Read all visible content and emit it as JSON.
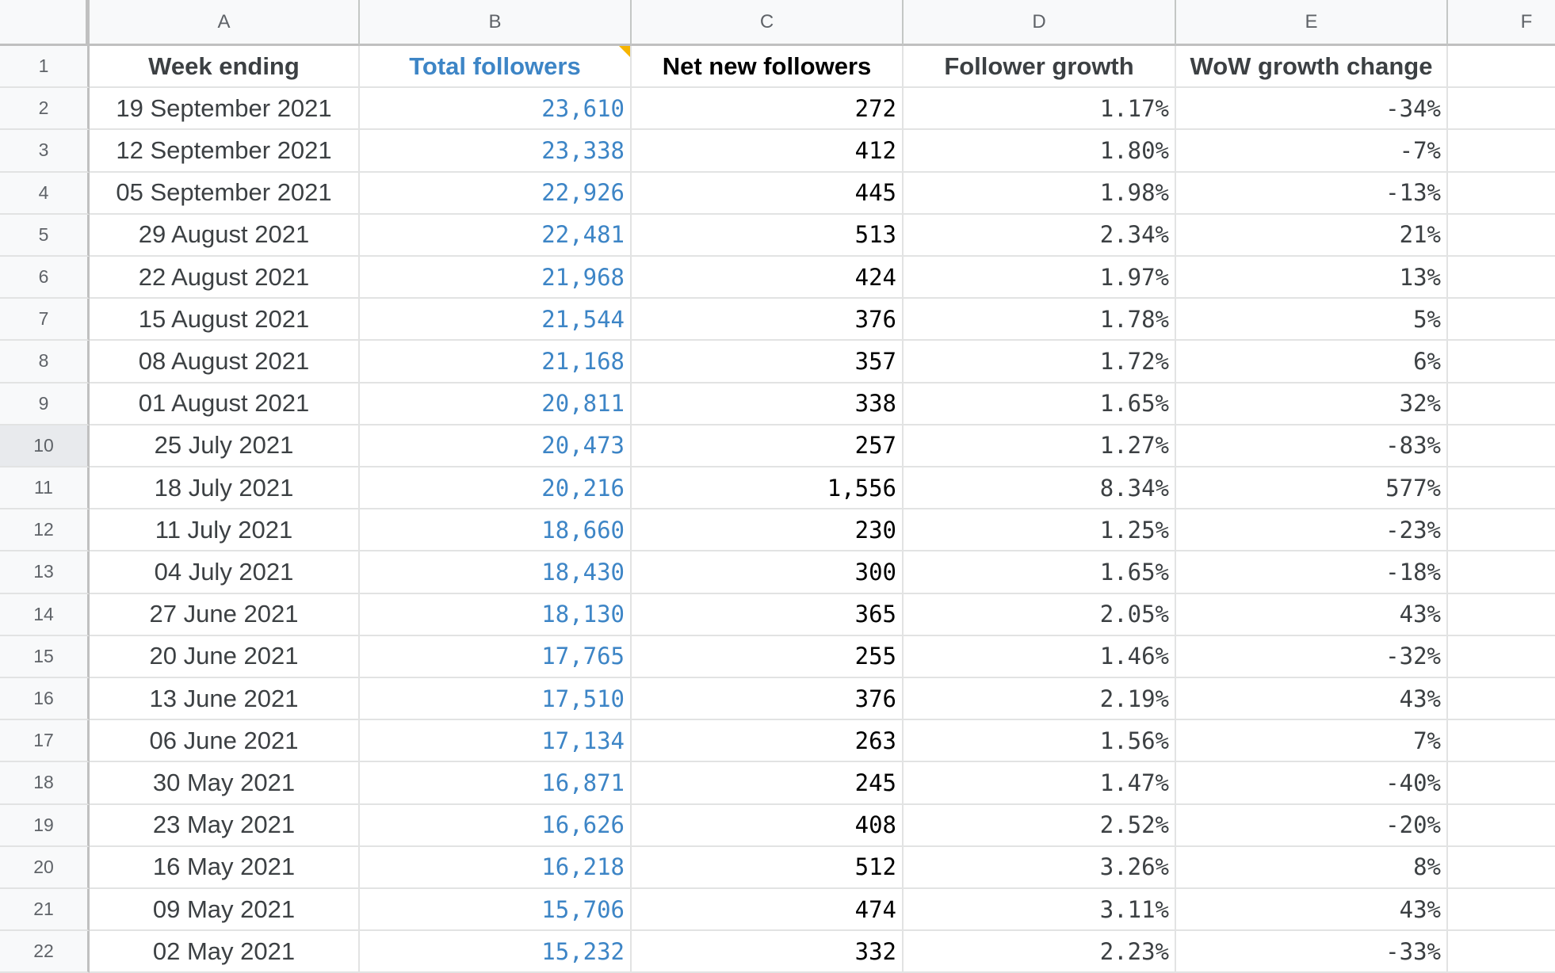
{
  "sheet": {
    "columns": [
      "A",
      "B",
      "C",
      "D",
      "E",
      "F"
    ],
    "hovered_row": 10,
    "header_row": {
      "row_number": "1",
      "cells": [
        "Week ending",
        "Total followers",
        "Net new followers",
        "Follower growth",
        "WoW growth change"
      ],
      "comment_on_cell": "B1"
    },
    "rows": [
      {
        "n": "2",
        "week": "19 September 2021",
        "total": "23,610",
        "net": "272",
        "growth": "1.17%",
        "wow": "-34%"
      },
      {
        "n": "3",
        "week": "12 September 2021",
        "total": "23,338",
        "net": "412",
        "growth": "1.80%",
        "wow": "-7%"
      },
      {
        "n": "4",
        "week": "05 September 2021",
        "total": "22,926",
        "net": "445",
        "growth": "1.98%",
        "wow": "-13%"
      },
      {
        "n": "5",
        "week": "29 August 2021",
        "total": "22,481",
        "net": "513",
        "growth": "2.34%",
        "wow": "21%"
      },
      {
        "n": "6",
        "week": "22 August 2021",
        "total": "21,968",
        "net": "424",
        "growth": "1.97%",
        "wow": "13%"
      },
      {
        "n": "7",
        "week": "15 August 2021",
        "total": "21,544",
        "net": "376",
        "growth": "1.78%",
        "wow": "5%"
      },
      {
        "n": "8",
        "week": "08 August 2021",
        "total": "21,168",
        "net": "357",
        "growth": "1.72%",
        "wow": "6%"
      },
      {
        "n": "9",
        "week": "01 August 2021",
        "total": "20,811",
        "net": "338",
        "growth": "1.65%",
        "wow": "32%"
      },
      {
        "n": "10",
        "week": "25 July 2021",
        "total": "20,473",
        "net": "257",
        "growth": "1.27%",
        "wow": "-83%"
      },
      {
        "n": "11",
        "week": "18 July 2021",
        "total": "20,216",
        "net": "1,556",
        "growth": "8.34%",
        "wow": "577%"
      },
      {
        "n": "12",
        "week": "11 July 2021",
        "total": "18,660",
        "net": "230",
        "growth": "1.25%",
        "wow": "-23%"
      },
      {
        "n": "13",
        "week": "04 July 2021",
        "total": "18,430",
        "net": "300",
        "growth": "1.65%",
        "wow": "-18%"
      },
      {
        "n": "14",
        "week": "27 June 2021",
        "total": "18,130",
        "net": "365",
        "growth": "2.05%",
        "wow": "43%"
      },
      {
        "n": "15",
        "week": "20 June 2021",
        "total": "17,765",
        "net": "255",
        "growth": "1.46%",
        "wow": "-32%"
      },
      {
        "n": "16",
        "week": "13 June 2021",
        "total": "17,510",
        "net": "376",
        "growth": "2.19%",
        "wow": "43%"
      },
      {
        "n": "17",
        "week": "06 June 2021",
        "total": "17,134",
        "net": "263",
        "growth": "1.56%",
        "wow": "7%"
      },
      {
        "n": "18",
        "week": "30 May 2021",
        "total": "16,871",
        "net": "245",
        "growth": "1.47%",
        "wow": "-40%"
      },
      {
        "n": "19",
        "week": "23 May 2021",
        "total": "16,626",
        "net": "408",
        "growth": "2.52%",
        "wow": "-20%"
      },
      {
        "n": "20",
        "week": "16 May 2021",
        "total": "16,218",
        "net": "512",
        "growth": "3.26%",
        "wow": "8%"
      },
      {
        "n": "21",
        "week": "09 May 2021",
        "total": "15,706",
        "net": "474",
        "growth": "3.11%",
        "wow": "43%"
      },
      {
        "n": "22",
        "week": "02 May 2021",
        "total": "15,232",
        "net": "332",
        "growth": "2.23%",
        "wow": "-33%"
      }
    ]
  },
  "colors": {
    "accent_blue": "#3d85c6",
    "comment_indicator": "#f6b400",
    "header_bg": "#f8f9fa",
    "text_dark": "#3c4043"
  }
}
